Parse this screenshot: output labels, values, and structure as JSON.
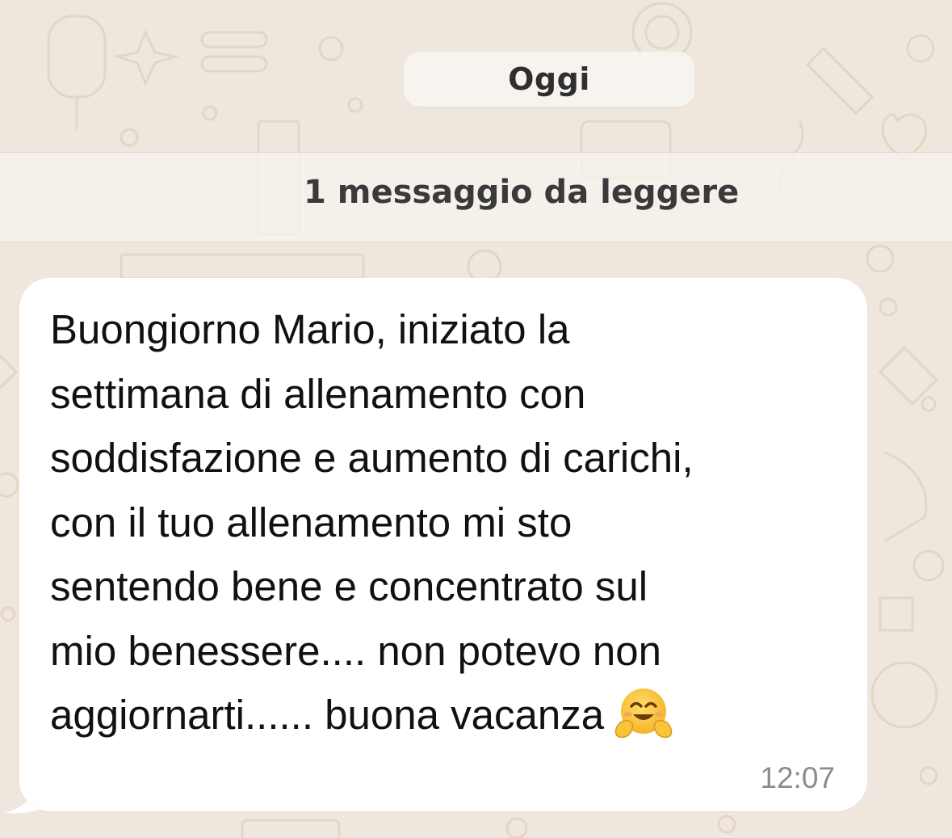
{
  "chat": {
    "date_separator": "Oggi",
    "unread_banner": "1 messaggio da leggere",
    "message": {
      "lines": [
        "Buongiorno Mario, iniziato la",
        "settimana di allenamento con",
        "soddisfazione e aumento di carichi,",
        "con il tuo allenamento mi sto",
        "sentendo bene e concentrato sul",
        "mio benessere.... non potevo non",
        "aggiornarti...... buona vacanza"
      ],
      "emoji_icon": "hugging-face-emoji",
      "time": "12:07"
    },
    "colors": {
      "wallpaper": "#efe7dd",
      "bubble": "#ffffff",
      "text": "#111111",
      "timestamp": "#8c8c8c"
    }
  }
}
